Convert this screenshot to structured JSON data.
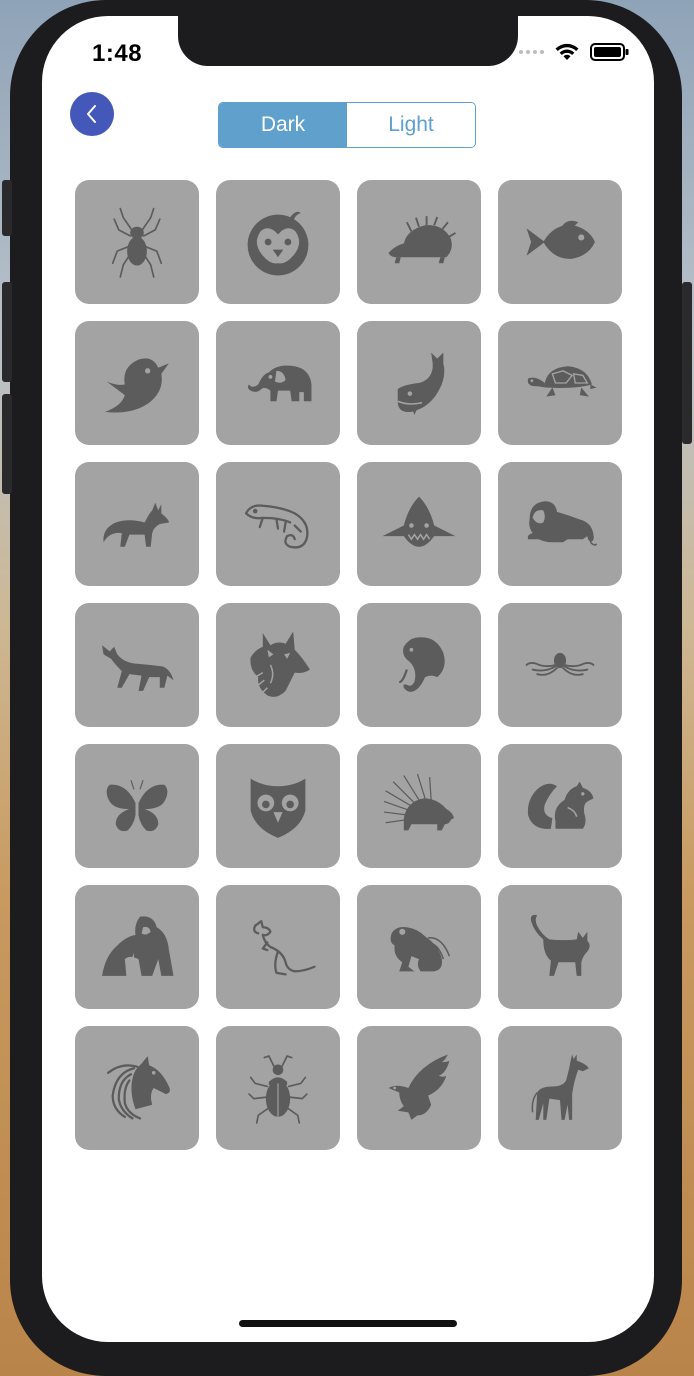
{
  "status_bar": {
    "time": "1:48"
  },
  "toolbar": {
    "back_icon": "chevron-left-icon",
    "segments": [
      {
        "label": "Dark",
        "selected": true
      },
      {
        "label": "Light",
        "selected": false
      }
    ]
  },
  "colors": {
    "accent": "#5fa0cc",
    "back_button": "#4358b8",
    "tile_background": "#a3a3a3",
    "icon_fill": "#5c5c5c"
  },
  "animals": [
    "spider",
    "penguin",
    "hedgehog",
    "fish",
    "bird",
    "elephant",
    "whale",
    "turtle",
    "fox",
    "chameleon",
    "shark",
    "lion",
    "wolf",
    "wolf-head",
    "elephant-head",
    "octopus",
    "butterfly",
    "owl",
    "porcupine",
    "squirrel",
    "gorilla",
    "kangaroo",
    "frog",
    "cat",
    "horse",
    "beetle",
    "eagle",
    "giraffe"
  ]
}
